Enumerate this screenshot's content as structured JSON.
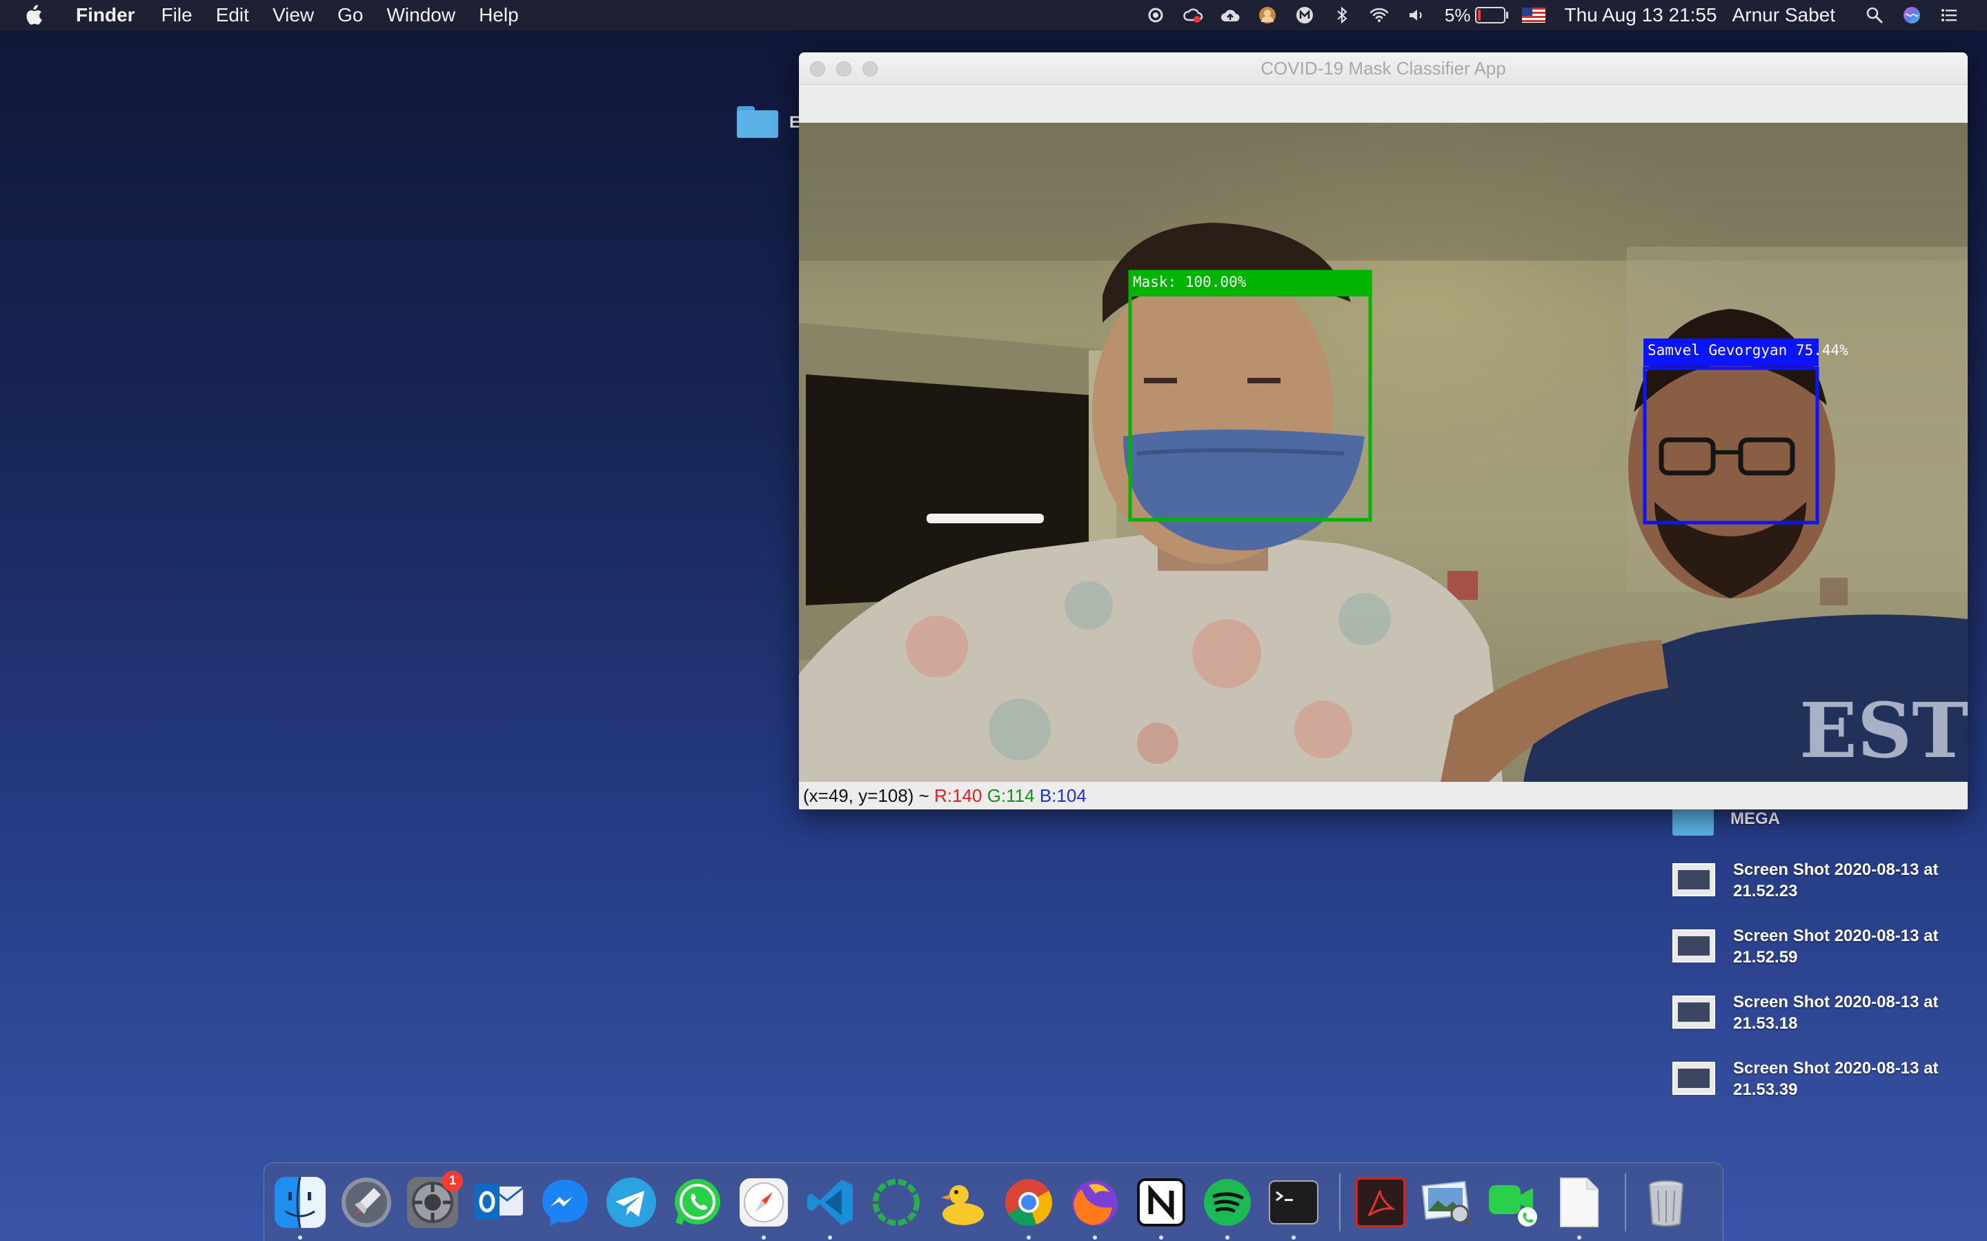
{
  "menubar": {
    "app_name": "Finder",
    "menus": [
      "File",
      "Edit",
      "View",
      "Go",
      "Window",
      "Help"
    ],
    "battery_percent": "5%",
    "clock": "Thu Aug 13  21:55",
    "user": "Arnur Sabet",
    "status_icons": [
      "record-icon",
      "creative-cloud-icon",
      "cloud-upload-icon",
      "avatar-app-icon",
      "mega-icon",
      "bluetooth-icon",
      "wifi-icon",
      "volume-icon"
    ]
  },
  "desktop": {
    "partial_folder_label": "E",
    "items": [
      {
        "type": "folder",
        "name": "MEGA"
      },
      {
        "type": "screenshot",
        "name": "Screen Shot 2020-08-13 at 21.52.23"
      },
      {
        "type": "screenshot",
        "name": "Screen Shot 2020-08-13 at 21.52.59"
      },
      {
        "type": "screenshot",
        "name": "Screen Shot 2020-08-13 at 21.53.18"
      },
      {
        "type": "screenshot",
        "name": "Screen Shot 2020-08-13 at 21.53.39"
      }
    ]
  },
  "window": {
    "title": "COVID-19 Mask Classifier App",
    "detections": [
      {
        "label": "Mask: 100.00%",
        "color": "#00b400"
      },
      {
        "label": "Samvel Gevorgyan 75.44%",
        "color": "#0a14ff"
      }
    ],
    "status": {
      "coords": "(x=49, y=108) ~",
      "r": "R:140",
      "g": "G:114",
      "b": "B:104"
    }
  },
  "dock": {
    "apps": [
      {
        "name": "Finder",
        "icon": "finder-icon",
        "running": true
      },
      {
        "name": "Launchpad",
        "icon": "launchpad-icon",
        "running": false
      },
      {
        "name": "System Preferences",
        "icon": "system-preferences-icon",
        "running": false,
        "badge": "1"
      },
      {
        "name": "Microsoft Outlook",
        "icon": "outlook-icon",
        "running": false
      },
      {
        "name": "Messenger",
        "icon": "messenger-icon",
        "running": false
      },
      {
        "name": "Telegram",
        "icon": "telegram-icon",
        "running": false
      },
      {
        "name": "WhatsApp",
        "icon": "whatsapp-icon",
        "running": false
      },
      {
        "name": "Safari",
        "icon": "safari-icon",
        "running": true
      },
      {
        "name": "Visual Studio Code",
        "icon": "vscode-icon",
        "running": true
      },
      {
        "name": "Qbserve",
        "icon": "ring-app-icon",
        "running": false
      },
      {
        "name": "Cyberduck",
        "icon": "cyberduck-icon",
        "running": false
      },
      {
        "name": "Google Chrome",
        "icon": "chrome-icon",
        "running": true
      },
      {
        "name": "Firefox",
        "icon": "firefox-icon",
        "running": true
      },
      {
        "name": "Notion",
        "icon": "notion-icon",
        "running": true
      },
      {
        "name": "Spotify",
        "icon": "spotify-icon",
        "running": true
      },
      {
        "name": "Terminal",
        "icon": "terminal-icon",
        "running": true
      }
    ],
    "recent": [
      {
        "name": "Acrobat",
        "icon": "acrobat-icon",
        "running": false
      },
      {
        "name": "Preview",
        "icon": "preview-icon",
        "running": false
      },
      {
        "name": "FaceTime",
        "icon": "facetime-icon",
        "running": false
      },
      {
        "name": "Document",
        "icon": "document-icon",
        "running": true
      }
    ],
    "trash": {
      "name": "Trash",
      "icon": "trash-icon"
    }
  }
}
